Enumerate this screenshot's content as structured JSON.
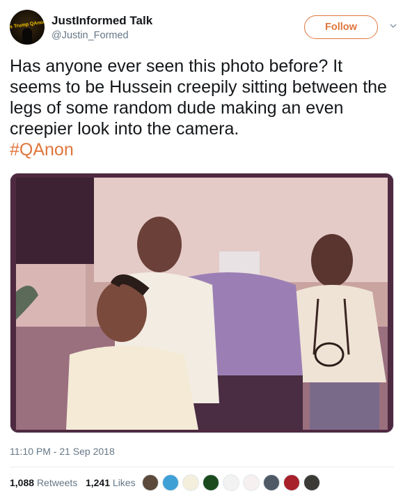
{
  "user": {
    "display_name": "JustInformed Talk",
    "handle": "@Justin_Formed",
    "avatar_text": "Is Trump QAnon?"
  },
  "follow_label": "Follow",
  "tweet": {
    "text": "Has anyone ever seen this photo before? It seems to be Hussein creepily sitting between the legs of some random dude making an even creepier look into the camera.",
    "hashtag": "#QAnon"
  },
  "timestamp": "11:10 PM - 21 Sep 2018",
  "stats": {
    "retweets_count": "1,088",
    "retweets_label": "Retweets",
    "likes_count": "1,241",
    "likes_label": "Likes"
  },
  "liker_avatars": [
    {
      "icon": "liker-avatar-1-icon",
      "color": "#5c4a3a"
    },
    {
      "icon": "liker-avatar-2-icon",
      "color": "#3fa0d6"
    },
    {
      "icon": "liker-avatar-3-icon",
      "color": "#f4eedc"
    },
    {
      "icon": "liker-avatar-4-icon",
      "color": "#1b4a1e"
    },
    {
      "icon": "liker-avatar-5-icon",
      "color": "#f2f2f2"
    },
    {
      "icon": "liker-avatar-6-icon",
      "color": "#f6f0f0"
    },
    {
      "icon": "liker-avatar-7-icon",
      "color": "#4f5a66"
    },
    {
      "icon": "liker-avatar-8-icon",
      "color": "#a8202a"
    },
    {
      "icon": "liker-avatar-9-icon",
      "color": "#3c3a36"
    }
  ],
  "colors": {
    "accent": "#e0763c",
    "text": "#14171a",
    "secondary_text": "#657786"
  }
}
